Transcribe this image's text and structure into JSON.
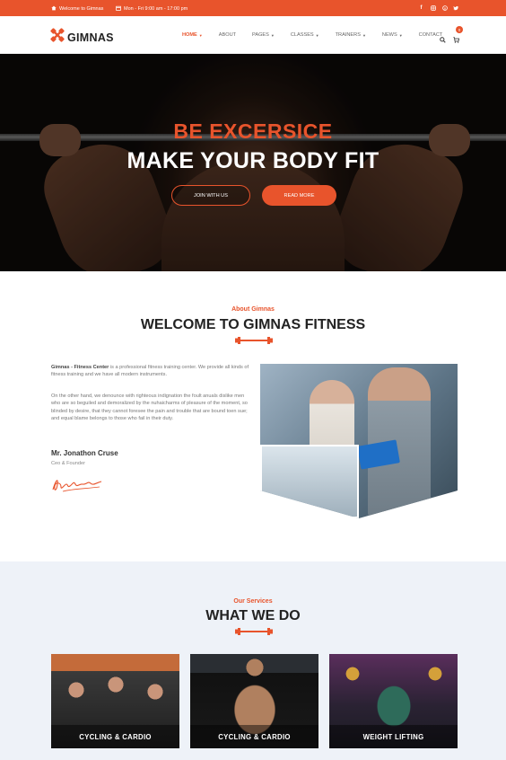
{
  "topbar": {
    "welcome": "Welcome to Gimnas",
    "hours": "Mon - Fri 9:00 am - 17:00 pm",
    "social": [
      "facebook-icon",
      "instagram-icon",
      "skype-icon",
      "twitter-icon"
    ]
  },
  "header": {
    "logo_text": "GIMNAS",
    "nav": [
      {
        "label": "HOME",
        "dropdown": true,
        "active": true
      },
      {
        "label": "ABOUT",
        "dropdown": false
      },
      {
        "label": "PAGES",
        "dropdown": true
      },
      {
        "label": "CLASSES",
        "dropdown": true
      },
      {
        "label": "TRAINERS",
        "dropdown": true
      },
      {
        "label": "NEWS",
        "dropdown": true
      },
      {
        "label": "CONTACT",
        "dropdown": false
      }
    ],
    "cart_count": "0"
  },
  "hero": {
    "tagline": "BE EXCERSICE",
    "headline": "MAKE YOUR BODY FIT",
    "join_label": "JOIN WITH US",
    "read_label": "READ MORE"
  },
  "about": {
    "label": "About Gimnas",
    "title": "WELCOME TO GIMNAS FITNESS",
    "intro_strong": "Gimnas - Fitness Center",
    "intro_rest": " is a professional fitness training center. We provide all kinds of fitness training and we have all modern instruments.",
    "paragraph": "On the other hand, we denounce with righteous indignation the foult anuals dislike men who are so beguiled and demoralized by the nuhaicharms of pleasure of the moment, so blinded by desire, that they cannot foresee the pain and trouble that are bound toen sue; and equal blame belongs to those who fail in their duty.",
    "signer_name": "Mr. Jonathon Cruse",
    "signer_role": "Ceo & Founder"
  },
  "services": {
    "label": "Our Services",
    "title": "WHAT WE DO",
    "cards": [
      {
        "label": "CYCLING & CARDIO"
      },
      {
        "label": "CYCLING & CARDIO"
      },
      {
        "label": "WEIGHT LIFTING"
      }
    ]
  },
  "colors": {
    "accent": "#e8542c",
    "dark": "#222222",
    "services_bg": "#eef2f8"
  }
}
